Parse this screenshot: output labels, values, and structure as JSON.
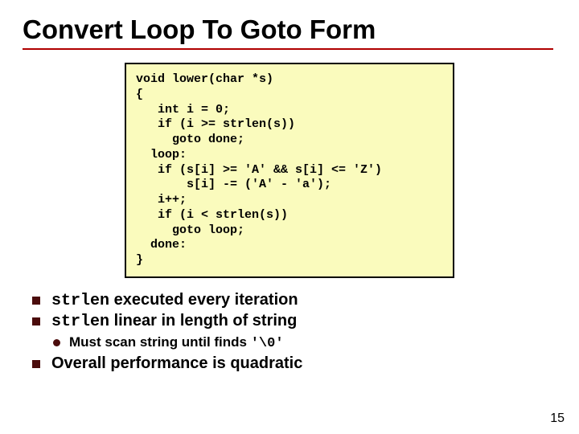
{
  "title": "Convert Loop To Goto Form",
  "code": "void lower(char *s)\n{\n   int i = 0;\n   if (i >= strlen(s))\n     goto done;\n  loop:\n   if (s[i] >= 'A' && s[i] <= 'Z')\n       s[i] -= ('A' - 'a');\n   i++;\n   if (i < strlen(s))\n     goto loop;\n  done:\n}",
  "bullets": {
    "b1_code": "strlen",
    "b1_text": " executed every iteration",
    "b2_code": "strlen",
    "b2_text": " linear in length of string",
    "sub1_text_pre": "Must scan string until finds ",
    "sub1_code": "'\\0'",
    "b3_text": "Overall performance is quadratic"
  },
  "page_number": "15"
}
